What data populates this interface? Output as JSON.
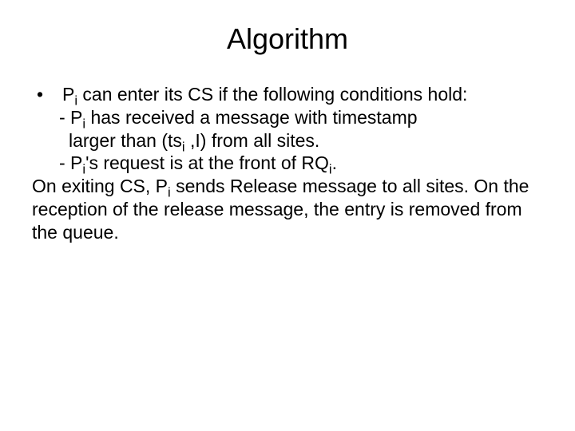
{
  "title": "Algorithm",
  "lines": {
    "l1a": "P",
    "l1b": "i",
    "l1c": " can enter its CS if the following conditions hold:",
    "l2a": "- P",
    "l2b": "i",
    "l2c": " has received a message with timestamp",
    "l3a": " larger than (ts",
    "l3b": "i",
    "l3c": " ,I) from all sites.",
    "l4a": "- P",
    "l4b": "i",
    "l4c": "'s request is at the front of RQ",
    "l4d": "i",
    "l4e": ".",
    "l5a": "On exiting CS, P",
    "l5b": "i",
    "l5c": " sends Release message to all sites. On the reception of the release message, the entry is removed from the queue."
  },
  "bullet": "•"
}
